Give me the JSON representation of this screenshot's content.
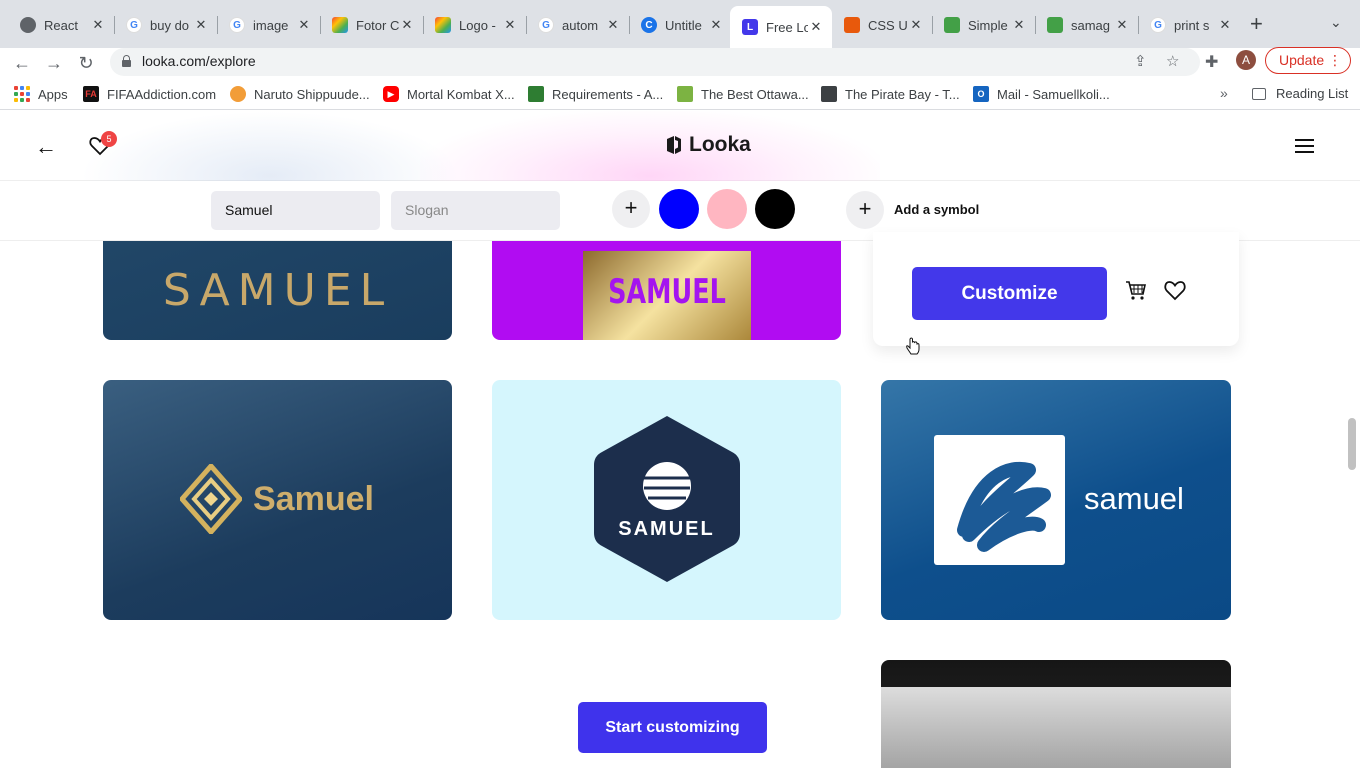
{
  "browser": {
    "tabs": [
      {
        "label": "React",
        "color": "#5f6368"
      },
      {
        "label": "buy do",
        "color": "#4285f4"
      },
      {
        "label": "image",
        "color": "#4285f4"
      },
      {
        "label": "Fotor C",
        "color": "#e94b3c"
      },
      {
        "label": "Logo -",
        "color": "#f5a623"
      },
      {
        "label": "autom",
        "color": "#4285f4"
      },
      {
        "label": "Untitle",
        "color": "#1a73e8"
      },
      {
        "label": "Free Lo",
        "color": "#4338ea"
      },
      {
        "label": "CSS U",
        "color": "#e8590c"
      },
      {
        "label": "Simple",
        "color": "#43a047"
      },
      {
        "label": "samag",
        "color": "#43a047"
      },
      {
        "label": "print s",
        "color": "#4285f4"
      }
    ],
    "url": "looka.com/explore",
    "avatar_letter": "A",
    "update_label": "Update",
    "bookmarks": [
      {
        "label": "Apps"
      },
      {
        "label": "FIFAAddiction.com",
        "icon_text": "FA",
        "color": "#111111"
      },
      {
        "label": "Naruto Shippuude...",
        "color": "#f29d38"
      },
      {
        "label": "Mortal Kombat X...",
        "color": "#ff0000"
      },
      {
        "label": "Requirements - A...",
        "color": "#2e7d32"
      },
      {
        "label": "The Best Ottawa...",
        "color": "#7cb342"
      },
      {
        "label": "The Pirate Bay - T...",
        "color": "#3c4043"
      },
      {
        "label": "Mail - Samuellkoli...",
        "icon_text": "O",
        "color": "#1565c0"
      }
    ],
    "reading_list": "Reading List"
  },
  "header": {
    "brand": "Looka",
    "favorites_count": "5"
  },
  "controls": {
    "name_value": "Samuel",
    "slogan_placeholder": "Slogan",
    "colors": [
      "#0000ff",
      "#ffb6c1",
      "#000000"
    ],
    "add_symbol_label": "Add a symbol"
  },
  "cards": {
    "top_left_text": "SAMUEL",
    "top_middle_text": "SAMUEL",
    "mid_left_text": "Samuel",
    "mid_middle_text": "SAMUEL",
    "mid_right_text": "samuel"
  },
  "popup": {
    "customize_label": "Customize"
  },
  "footer": {
    "start_label": "Start customizing"
  }
}
